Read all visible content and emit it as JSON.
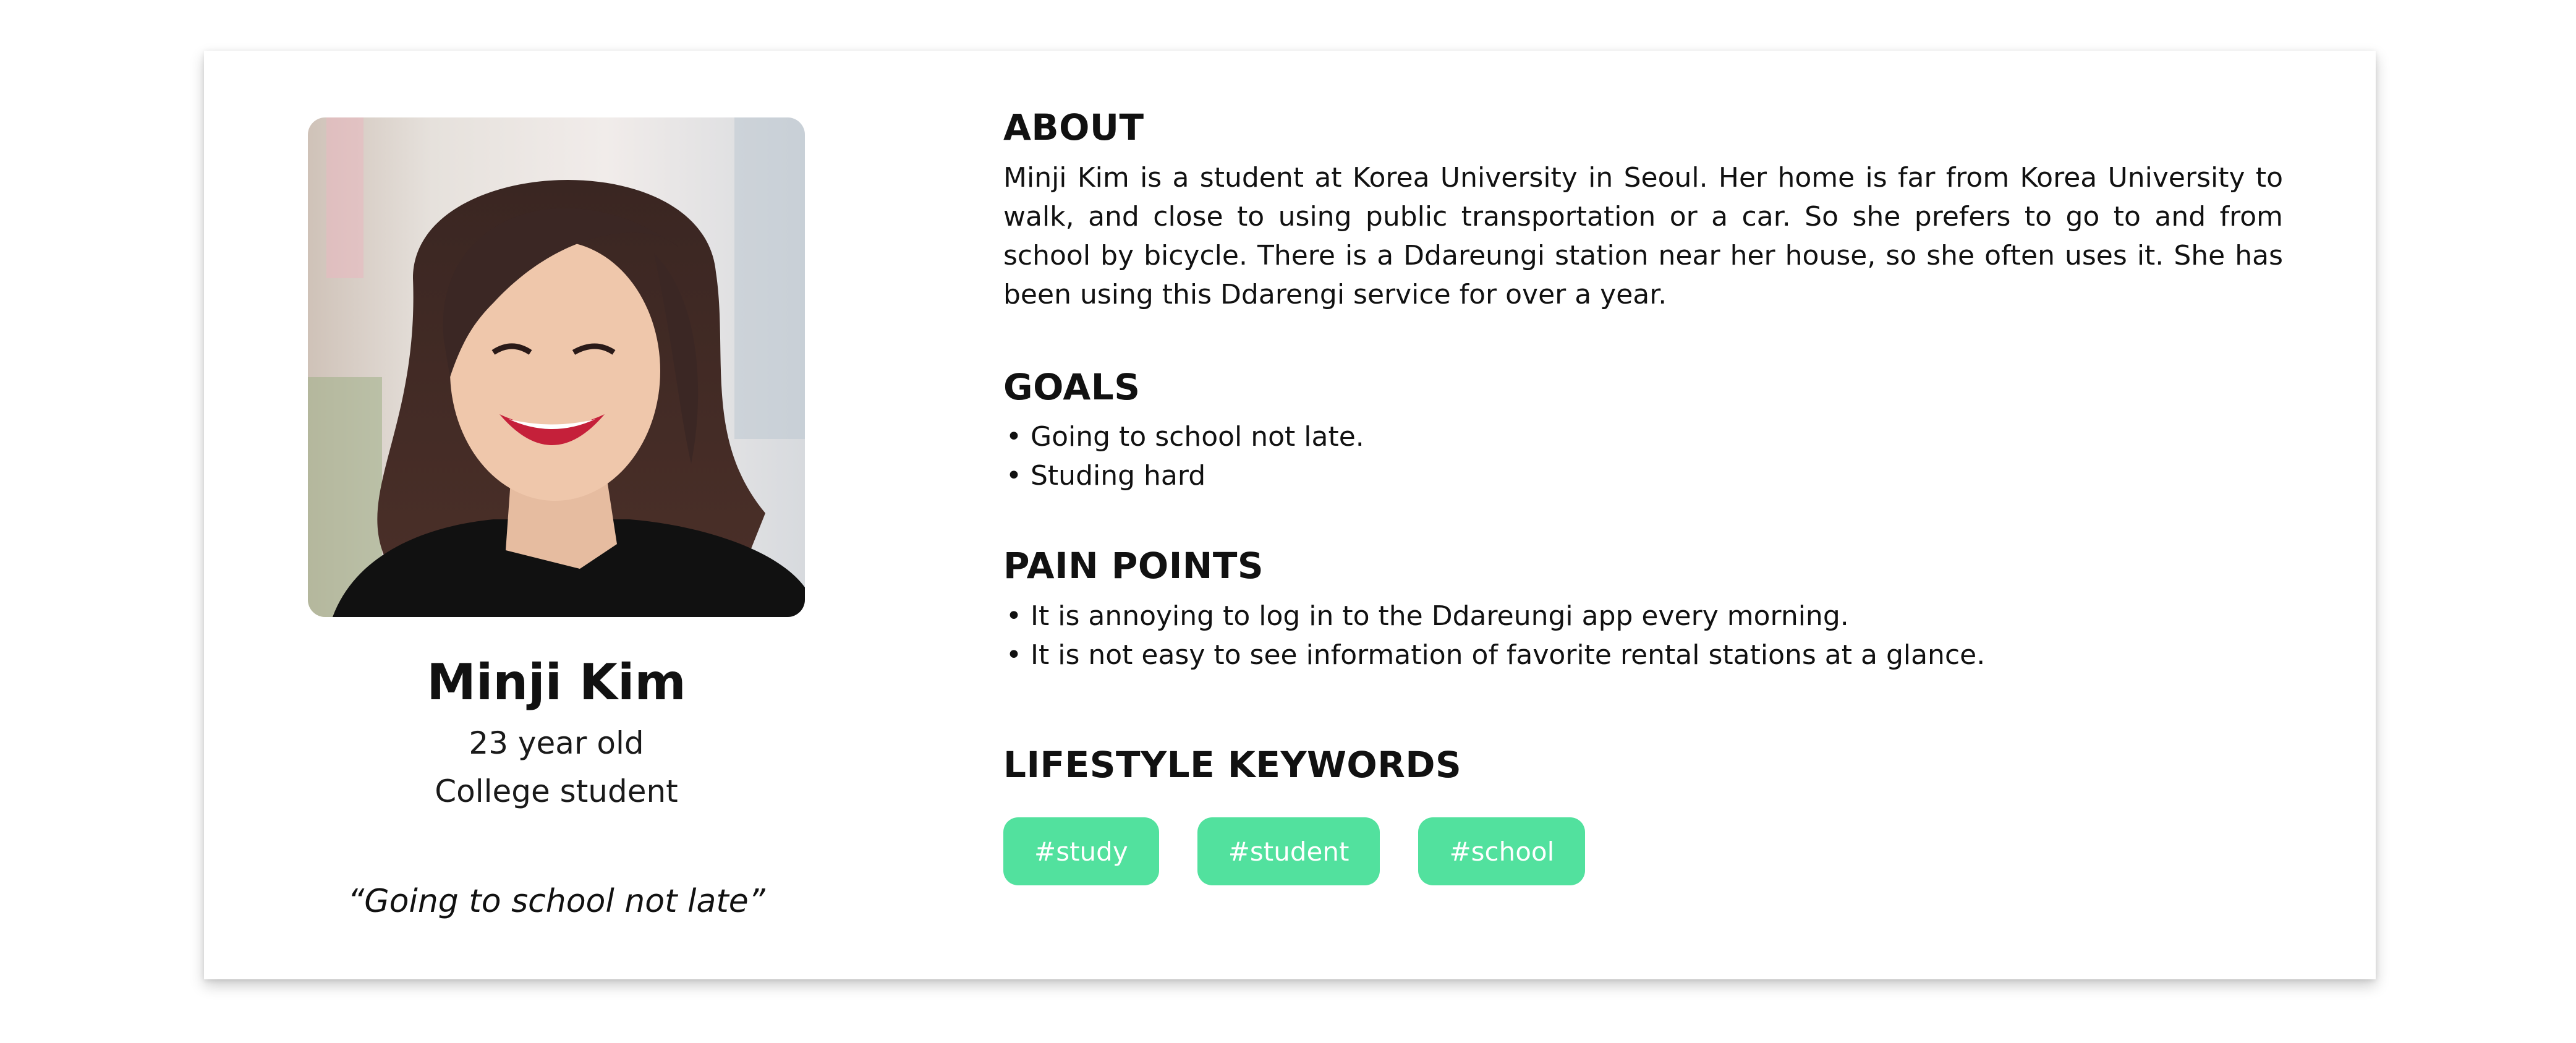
{
  "persona": {
    "name": "Minji Kim",
    "age": "23 year old",
    "role": "College student",
    "quote": "“Going to school not late”"
  },
  "about": {
    "heading": "ABOUT",
    "text": "Minji Kim is a student at Korea University in Seoul. Her home is far from Korea University to walk, and close to using public transportation or a car. So she prefers to go to and from school by bicycle. There is a Ddareungi station near her house, so she often uses it. She has been using this Ddarengi service for over a year."
  },
  "goals": {
    "heading": "GOALS",
    "items": [
      "Going to school not late.",
      "Studing hard"
    ]
  },
  "pain_points": {
    "heading": "PAIN POINTS",
    "items": [
      "It is annoying to log in to the Ddareungi app every morning.",
      "It is not easy to see information of favorite rental stations at a glance."
    ]
  },
  "lifestyle": {
    "heading": "LIFESTYLE KEYWORDS",
    "tags": [
      "#study",
      "#student",
      "#school"
    ]
  },
  "colors": {
    "tag_background": "#52e19e",
    "tag_text": "#ffffff",
    "card_background": "#ffffff"
  }
}
